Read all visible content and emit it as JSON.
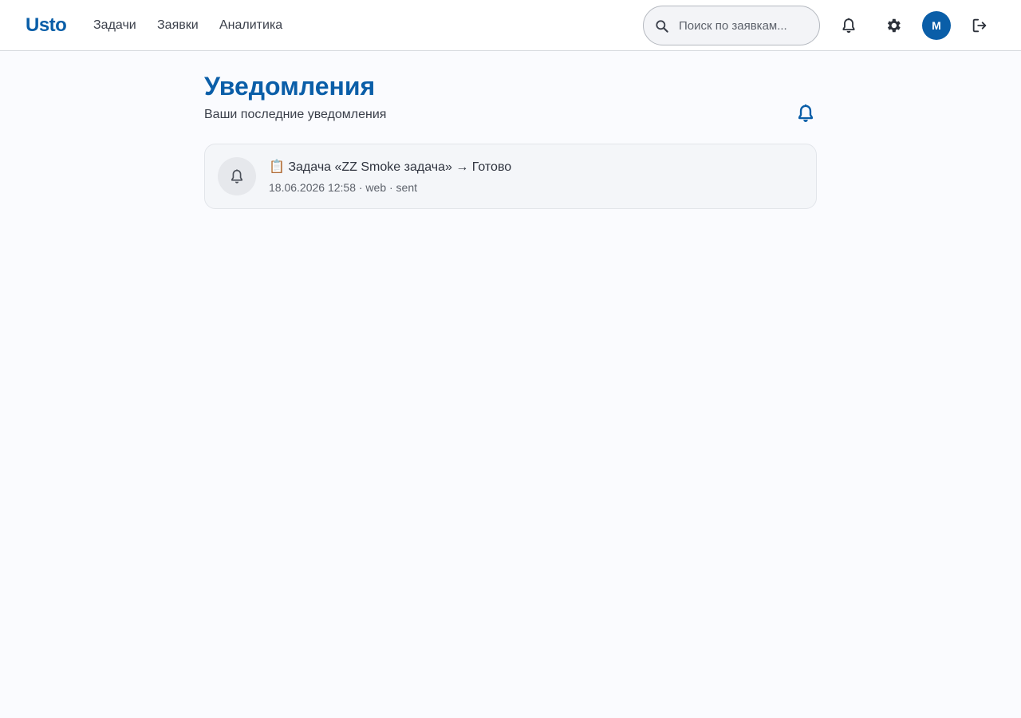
{
  "header": {
    "brand": "Usto",
    "nav": [
      {
        "label": "Задачи"
      },
      {
        "label": "Заявки"
      },
      {
        "label": "Аналитика"
      }
    ],
    "search": {
      "placeholder": "Поиск по заявкам...",
      "value": ""
    },
    "icons": {
      "search": "search-icon",
      "notifications": "bell-icon",
      "settings": "gear-icon",
      "logout": "logout-icon"
    },
    "avatar_initial": "M"
  },
  "page": {
    "title": "Уведомления",
    "subtitle": "Ваши последние уведомления",
    "header_icon": "bell-icon"
  },
  "notifications": [
    {
      "icon": "bell-icon",
      "title": "📋 Задача «ZZ Smoke задача» → Готово",
      "meta": "18.06.2026 12:58 · web · sent"
    }
  ],
  "colors": {
    "accent": "#0a5ea8",
    "background": "#fafbfe",
    "card": "#f4f6f9"
  }
}
